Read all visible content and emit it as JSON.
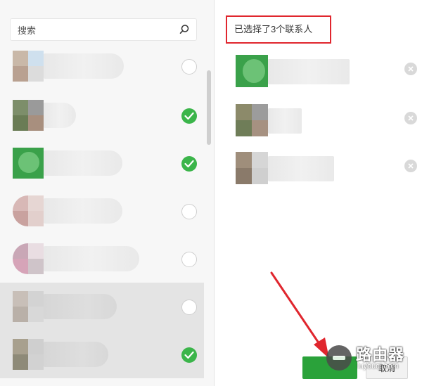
{
  "search": {
    "placeholder": "搜索"
  },
  "contacts": [
    {
      "checked": false
    },
    {
      "checked": true
    },
    {
      "checked": true
    },
    {
      "checked": false
    },
    {
      "checked": false
    },
    {
      "checked": false
    },
    {
      "checked": true
    }
  ],
  "selected": {
    "count_label": "已选择了3个联系人"
  },
  "actions": {
    "cancel_label": "取消"
  },
  "watermark": {
    "name": "路由器",
    "url": "luyouqi.com"
  },
  "colors": {
    "accent_green": "#3bb54a",
    "highlight_red": "#e0262e"
  },
  "icons": {
    "search": "search-icon",
    "check": "check-icon",
    "remove": "remove-icon"
  }
}
